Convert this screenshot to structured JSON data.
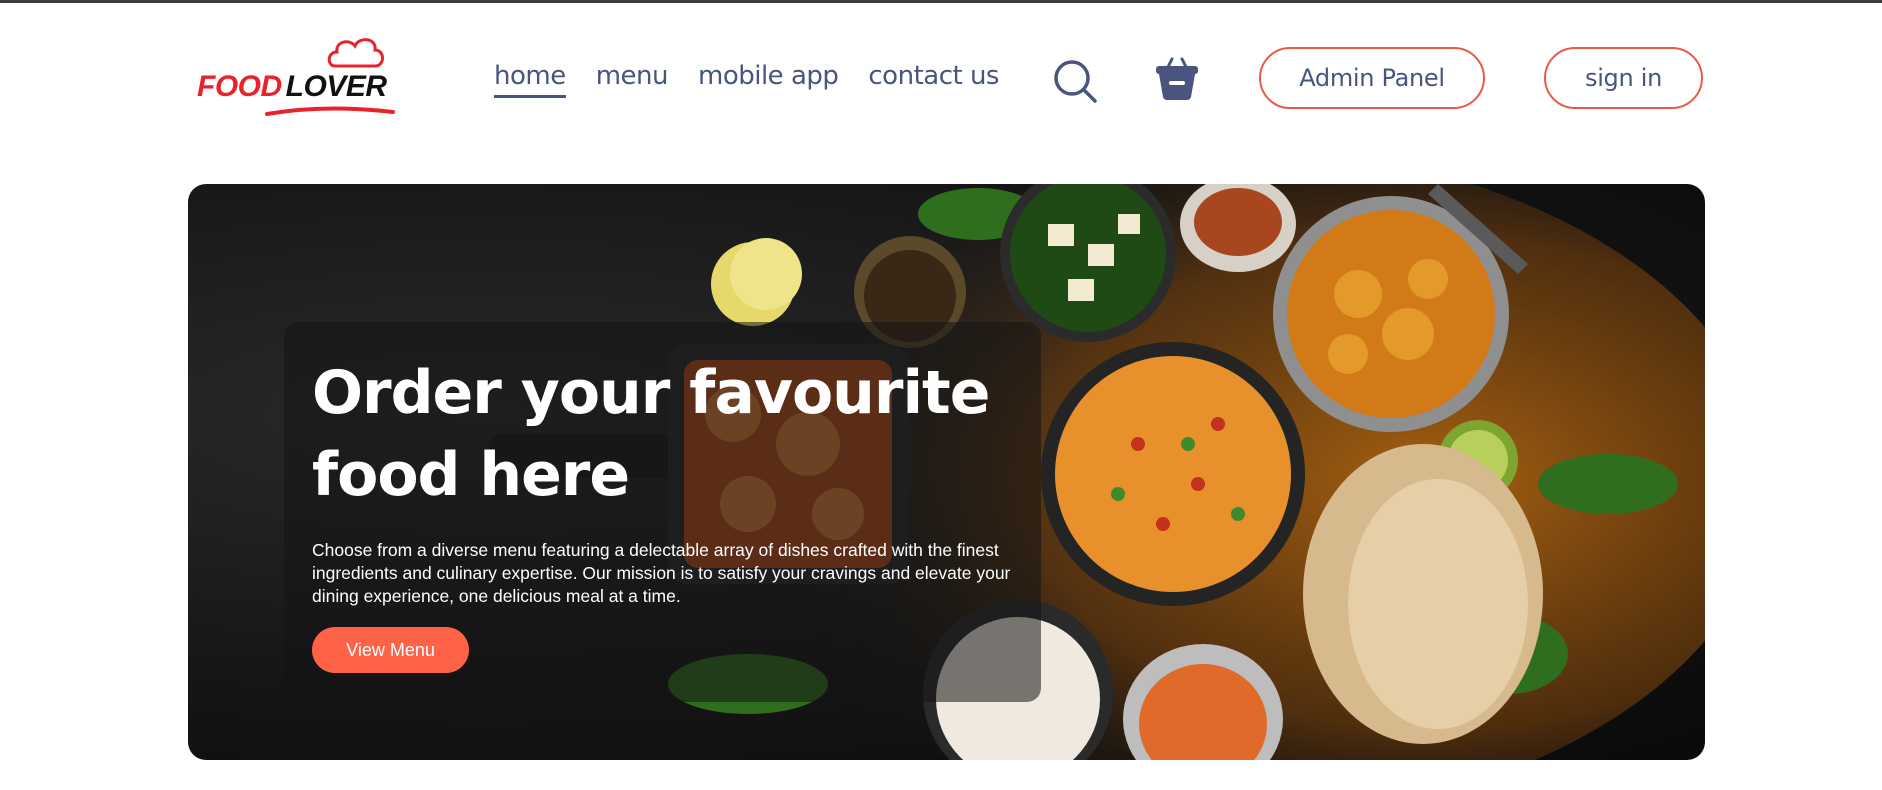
{
  "brand": {
    "logo_food": "FOOD",
    "logo_lover": "LOVER",
    "logo_icon": "chef-hat-icon",
    "primary_color": "#e8232b",
    "accent_color": "#ff6347",
    "nav_text_color": "#49557e"
  },
  "nav": {
    "links": [
      {
        "label": "home",
        "active": true
      },
      {
        "label": "menu",
        "active": false
      },
      {
        "label": "mobile app",
        "active": false
      },
      {
        "label": "contact us",
        "active": false
      }
    ],
    "search_icon": "search-icon",
    "basket_icon": "basket-icon",
    "admin_label": "Admin Panel",
    "signin_label": "sign in"
  },
  "hero": {
    "title": "Order your favourite food here",
    "description": "Choose from a diverse menu featuring a delectable array of dishes crafted with the finest ingredients and culinary expertise. Our mission is to satisfy your cravings and elevate your dining experience, one delicious meal at a time.",
    "button_label": "View Menu"
  }
}
